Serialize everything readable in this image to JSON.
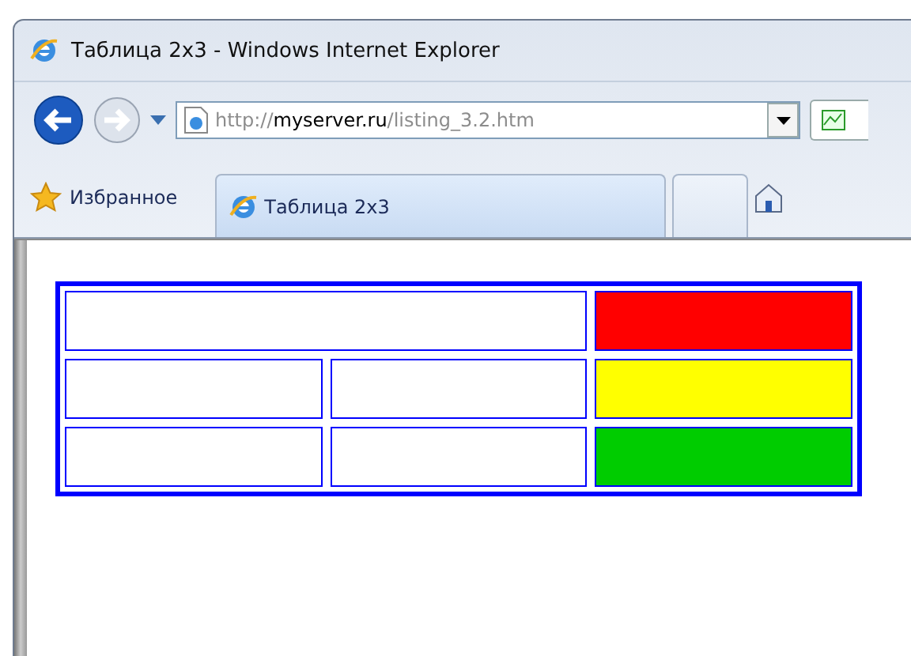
{
  "window": {
    "title": "Таблица 2x3 - Windows Internet Explorer"
  },
  "address_bar": {
    "scheme": "http://",
    "host": "myserver.ru",
    "path": "/listing_3.2.htm"
  },
  "favorites": {
    "label": "Избранное"
  },
  "tabs": [
    {
      "label": "Таблица 2x3",
      "selected": true
    },
    {
      "selected": false
    }
  ],
  "table": {
    "rows": [
      {
        "cells": [
          {
            "kind": "wide",
            "color": "#ffffff"
          },
          {
            "kind": "normal",
            "color": "#ff0000"
          }
        ]
      },
      {
        "cells": [
          {
            "kind": "normal",
            "color": "#ffffff"
          },
          {
            "kind": "normal",
            "color": "#ffffff"
          },
          {
            "kind": "normal",
            "color": "#ffff00"
          }
        ]
      },
      {
        "cells": [
          {
            "kind": "normal",
            "color": "#ffffff"
          },
          {
            "kind": "normal",
            "color": "#ffffff"
          },
          {
            "kind": "normal",
            "color": "#00cc00"
          }
        ]
      }
    ]
  }
}
